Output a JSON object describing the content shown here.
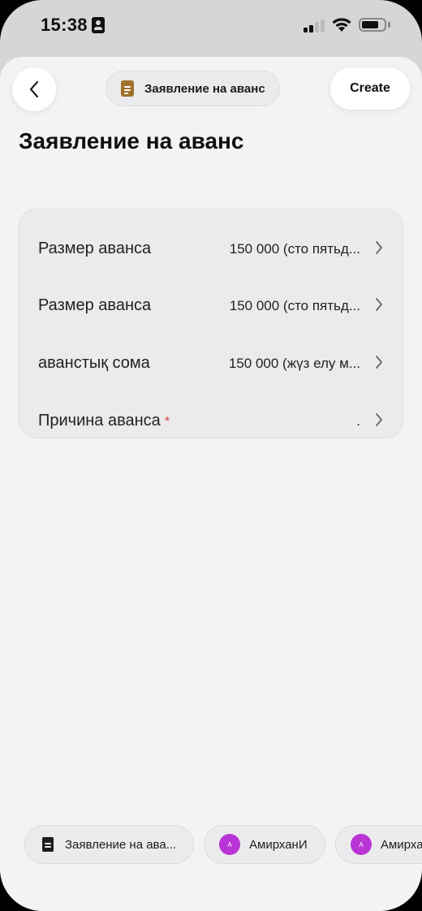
{
  "status_bar": {
    "time": "15:38"
  },
  "header": {
    "back_icon": "chevron-left-icon",
    "chip_icon": "document-icon",
    "chip_label": "Заявление на аванс",
    "create_label": "Create"
  },
  "page": {
    "title": "Заявление на аванс"
  },
  "form": {
    "rows": [
      {
        "label": "Размер аванса",
        "value": "150 000 (сто пятьд...",
        "required": false
      },
      {
        "label": "Размер аванса",
        "value": "150 000 (сто пятьд...",
        "required": false
      },
      {
        "label": "аванстық сома",
        "value": "150 000 (жүз елу м...",
        "required": false
      },
      {
        "label": "Причина аванса",
        "value": ".",
        "required": true,
        "required_mark": "*"
      }
    ]
  },
  "bottom_chips": [
    {
      "type": "document",
      "icon": "document-icon",
      "label": "Заявление на ава..."
    },
    {
      "type": "user",
      "avatar": "А",
      "label": "АмирханИ"
    },
    {
      "type": "user",
      "avatar": "А",
      "label": "Амирха"
    }
  ],
  "colors": {
    "sheet_background": "#f3f3f5",
    "card_background": "#ebebed",
    "required_mark": "#d64545",
    "avatar": "#b934d4",
    "chip_document_icon": "#a0712b"
  }
}
